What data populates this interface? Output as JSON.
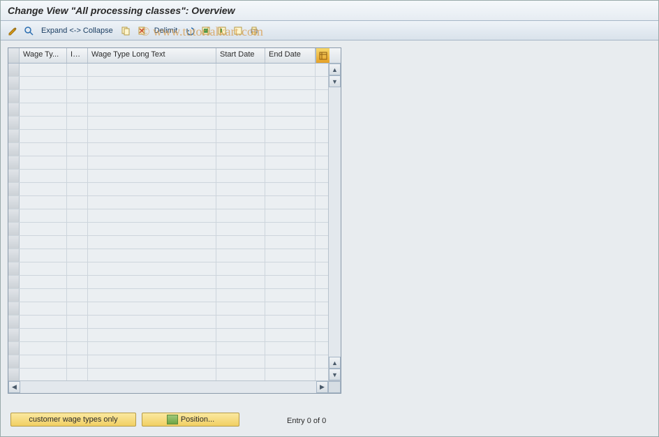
{
  "title": "Change View \"All processing classes\": Overview",
  "toolbar": {
    "expand_label": "Expand <-> Collapse",
    "delimit_label": "Delimit"
  },
  "table": {
    "columns": {
      "wage_type": "Wage Ty...",
      "info": "Inf...",
      "long_text": "Wage Type Long Text",
      "start_date": "Start Date",
      "end_date": "End Date"
    },
    "row_count": 24
  },
  "footer": {
    "customer_btn": "customer wage types only",
    "position_btn": "Position...",
    "entry_status": "Entry 0 of 0"
  },
  "watermark": "© www.tutorialkart.com"
}
